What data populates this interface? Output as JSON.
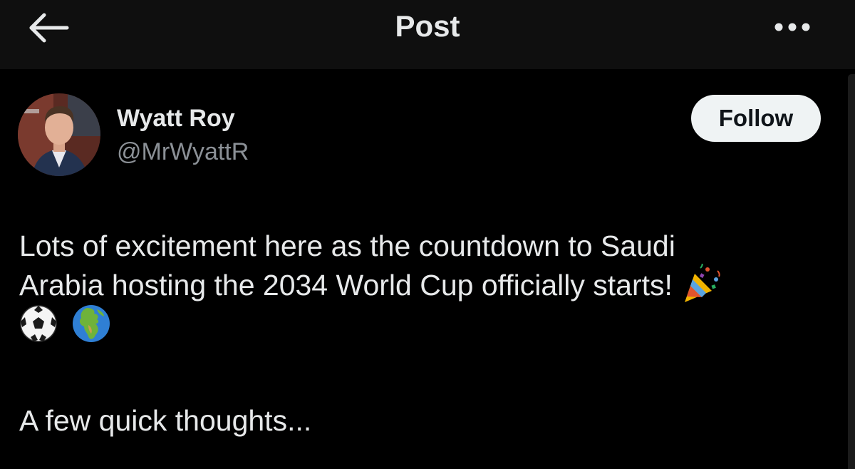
{
  "header": {
    "title": "Post",
    "back_icon": "arrow-left-icon",
    "more_icon": "more-horizontal-icon"
  },
  "author": {
    "name": "Wyatt Roy",
    "handle": "@MrWyattR",
    "follow_label": "Follow"
  },
  "post": {
    "line1": "Lots of excitement here as the countdown to Saudi",
    "line2": "Arabia hosting the 2034 World Cup officially starts!",
    "line3": "A few quick thoughts...",
    "emojis": [
      "party-popper-icon",
      "soccer-ball-icon",
      "globe-europe-africa-icon"
    ]
  },
  "colors": {
    "background": "#000000",
    "header_background": "#0f0f0f",
    "text_primary": "#e7e9ea",
    "text_secondary": "#8b9096",
    "follow_button_bg": "#eff3f4",
    "follow_button_text": "#0f1419"
  }
}
